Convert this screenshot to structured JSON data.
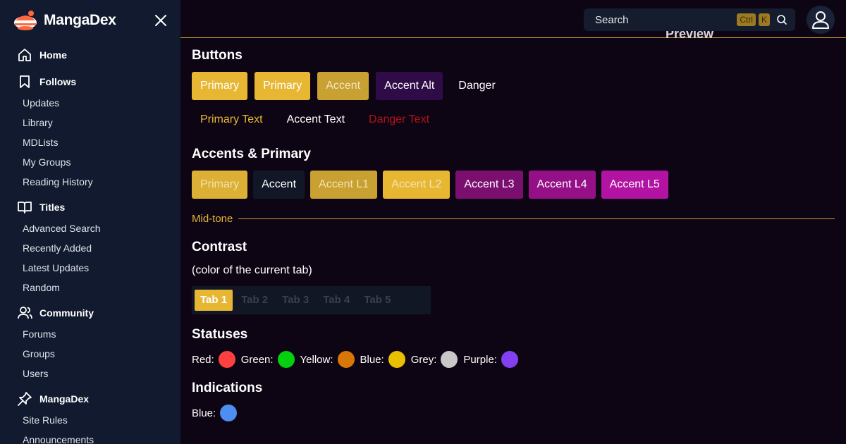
{
  "sidebar": {
    "brand": "MangaDex",
    "sections": [
      {
        "label": "Home",
        "icon": "home-icon",
        "items": []
      },
      {
        "label": "Follows",
        "icon": "bookmark-icon",
        "items": [
          "Updates",
          "Library",
          "MDLists",
          "My Groups",
          "Reading History"
        ]
      },
      {
        "label": "Titles",
        "icon": "book-open-icon",
        "items": [
          "Advanced Search",
          "Recently Added",
          "Latest Updates",
          "Random"
        ]
      },
      {
        "label": "Community",
        "icon": "users-icon",
        "items": [
          "Forums",
          "Groups",
          "Users"
        ]
      },
      {
        "label": "MangaDex",
        "icon": "pin-icon",
        "items": [
          "Site Rules",
          "Announcements"
        ]
      }
    ]
  },
  "header": {
    "search_label": "Search",
    "kbd_ctrl": "Ctrl",
    "kbd_k": "K",
    "peek_title": "Preview"
  },
  "buttons": {
    "heading": "Buttons",
    "solid": [
      {
        "label": "Primary",
        "bg": "#e7b734",
        "color": "#ffffff"
      },
      {
        "label": "Primary",
        "bg": "#e7b734",
        "color": "#ffffff"
      },
      {
        "label": "Accent",
        "bg": "#c9a032",
        "color": "#f2e5bf"
      },
      {
        "label": "Accent Alt",
        "bg": "#2f0b47",
        "color": "#ffffff"
      },
      {
        "label": "Danger",
        "bg": "transparent",
        "color": "#ffffff"
      }
    ],
    "text": [
      {
        "label": "Primary Text",
        "color": "#e7b734"
      },
      {
        "label": "Accent Text",
        "color": "#ffffff"
      },
      {
        "label": "Danger Text",
        "color": "#b3121a"
      }
    ]
  },
  "accents": {
    "heading": "Accents & Primary",
    "swatches": [
      {
        "label": "Primary",
        "bg": "#dcaf35",
        "color": "#f3e3b0"
      },
      {
        "label": "Accent",
        "bg": "#121728",
        "color": "#ffffff"
      },
      {
        "label": "Accent L1",
        "bg": "#c9a032",
        "color": "#f3e3b0"
      },
      {
        "label": "Accent L2",
        "bg": "#e7b734",
        "color": "#f3e3b0"
      },
      {
        "label": "Accent L3",
        "bg": "#7b0f70",
        "color": "#ffffff"
      },
      {
        "label": "Accent L4",
        "bg": "#951087",
        "color": "#ffffff"
      },
      {
        "label": "Accent L5",
        "bg": "#b313a2",
        "color": "#ffffff"
      }
    ],
    "midtone_label": "Mid-tone"
  },
  "contrast": {
    "heading": "Contrast",
    "note": "(color of the current tab)",
    "tabs": [
      "Tab 1",
      "Tab 2",
      "Tab 3",
      "Tab 4",
      "Tab 5"
    ],
    "active_index": 0
  },
  "statuses": {
    "heading": "Statuses",
    "items": [
      {
        "label": "Red:",
        "color": "#ff4040"
      },
      {
        "label": "Green:",
        "color": "#03d10d"
      },
      {
        "label": "Yellow:",
        "color": "#d87707"
      },
      {
        "label": "Blue:",
        "color": "#e8c000"
      },
      {
        "label": "Grey:",
        "color": "#c8c8c8"
      },
      {
        "label": "Purple:",
        "color": "#8240f2"
      }
    ]
  },
  "indications": {
    "heading": "Indications",
    "items": [
      {
        "label": "Blue:",
        "color": "#4d8ef0"
      }
    ]
  },
  "colors": {
    "sidebar_bg": "#111a2e",
    "page_bg": "#0e0514",
    "primary": "#e7b734",
    "midtone": "#c9a032"
  }
}
